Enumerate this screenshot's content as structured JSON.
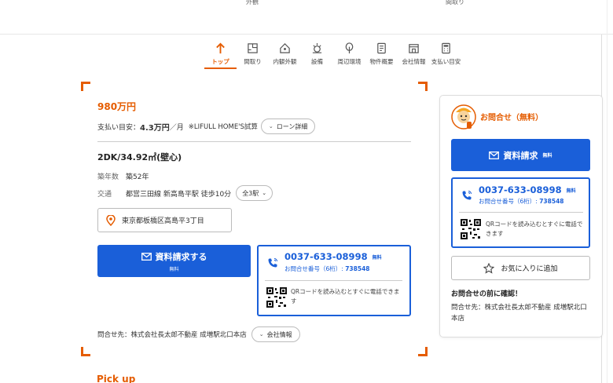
{
  "top_strip": {
    "left_caption": "外観",
    "right_caption": "間取り"
  },
  "nav": {
    "items": [
      {
        "label": "トップ",
        "icon": "arrow-up-icon",
        "active": true
      },
      {
        "label": "間取り",
        "icon": "floorplan-icon"
      },
      {
        "label": "内観外観",
        "icon": "house-icon"
      },
      {
        "label": "設備",
        "icon": "equipment-icon"
      },
      {
        "label": "周辺環境",
        "icon": "tree-icon"
      },
      {
        "label": "物件概要",
        "icon": "document-icon"
      },
      {
        "label": "会社情報",
        "icon": "shop-icon"
      },
      {
        "label": "支払い目安",
        "icon": "calculator-icon"
      }
    ]
  },
  "property": {
    "price": "980万円",
    "monthly_label": "支払い目安：",
    "monthly_value": "4.3万円",
    "monthly_unit": "／月",
    "monthly_note": "※LIFULL HOME'S試算",
    "loan_button": "ローン詳細",
    "layout": "2DK/34.92㎡(壁心)",
    "age_label": "築年数",
    "age_value": "築52年",
    "transport_label": "交通",
    "transport_value": "都営三田線 新高島平駅 徒歩10分",
    "stations_button": "全3駅",
    "address": "東京都板橋区高島平3丁目",
    "request_button": "資料請求する",
    "request_sub": "無料",
    "phone": "0037-633-08998",
    "phone_free": "無料",
    "inquiry_no_label": "お問合せ番号（6桁）:",
    "inquiry_no": "738548",
    "qr_text": "QRコードを読み込むとすぐに電話できます",
    "contact_label": "問合せ先：株式会社長太郎不動産 成増駅北口本店",
    "company_button": "会社情報"
  },
  "pickup": "Pick up",
  "sidebar": {
    "title": "お問合せ（無料）",
    "request_button": "資料請求",
    "request_free": "無料",
    "phone": "0037-633-08998",
    "phone_free": "無料",
    "inquiry_no_label": "お問合せ番号（6桁）:",
    "inquiry_no": "738548",
    "qr_text": "QRコードを読み込むとすぐに電話できます",
    "favorite_button": "お気に入りに追加",
    "note_heading": "お問合せの前に確認！",
    "contact": "問合せ先：株式会社長太郎不動産 成増駅北口本店"
  },
  "colors": {
    "accent": "#e55c00",
    "primary": "#1a5fd9"
  }
}
